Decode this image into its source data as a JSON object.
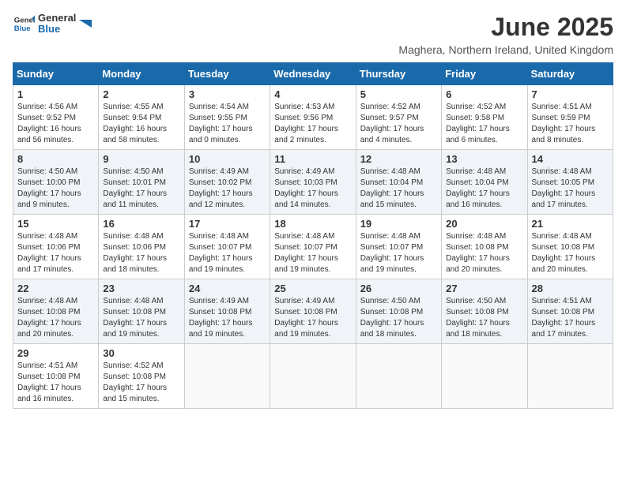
{
  "logo": {
    "general": "General",
    "blue": "Blue"
  },
  "title": "June 2025",
  "subtitle": "Maghera, Northern Ireland, United Kingdom",
  "days_header": [
    "Sunday",
    "Monday",
    "Tuesday",
    "Wednesday",
    "Thursday",
    "Friday",
    "Saturday"
  ],
  "weeks": [
    [
      {
        "day": "1",
        "sunrise": "4:56 AM",
        "sunset": "9:52 PM",
        "daylight": "16 hours and 56 minutes."
      },
      {
        "day": "2",
        "sunrise": "4:55 AM",
        "sunset": "9:54 PM",
        "daylight": "16 hours and 58 minutes."
      },
      {
        "day": "3",
        "sunrise": "4:54 AM",
        "sunset": "9:55 PM",
        "daylight": "17 hours and 0 minutes."
      },
      {
        "day": "4",
        "sunrise": "4:53 AM",
        "sunset": "9:56 PM",
        "daylight": "17 hours and 2 minutes."
      },
      {
        "day": "5",
        "sunrise": "4:52 AM",
        "sunset": "9:57 PM",
        "daylight": "17 hours and 4 minutes."
      },
      {
        "day": "6",
        "sunrise": "4:52 AM",
        "sunset": "9:58 PM",
        "daylight": "17 hours and 6 minutes."
      },
      {
        "day": "7",
        "sunrise": "4:51 AM",
        "sunset": "9:59 PM",
        "daylight": "17 hours and 8 minutes."
      }
    ],
    [
      {
        "day": "8",
        "sunrise": "4:50 AM",
        "sunset": "10:00 PM",
        "daylight": "17 hours and 9 minutes."
      },
      {
        "day": "9",
        "sunrise": "4:50 AM",
        "sunset": "10:01 PM",
        "daylight": "17 hours and 11 minutes."
      },
      {
        "day": "10",
        "sunrise": "4:49 AM",
        "sunset": "10:02 PM",
        "daylight": "17 hours and 12 minutes."
      },
      {
        "day": "11",
        "sunrise": "4:49 AM",
        "sunset": "10:03 PM",
        "daylight": "17 hours and 14 minutes."
      },
      {
        "day": "12",
        "sunrise": "4:48 AM",
        "sunset": "10:04 PM",
        "daylight": "17 hours and 15 minutes."
      },
      {
        "day": "13",
        "sunrise": "4:48 AM",
        "sunset": "10:04 PM",
        "daylight": "17 hours and 16 minutes."
      },
      {
        "day": "14",
        "sunrise": "4:48 AM",
        "sunset": "10:05 PM",
        "daylight": "17 hours and 17 minutes."
      }
    ],
    [
      {
        "day": "15",
        "sunrise": "4:48 AM",
        "sunset": "10:06 PM",
        "daylight": "17 hours and 17 minutes."
      },
      {
        "day": "16",
        "sunrise": "4:48 AM",
        "sunset": "10:06 PM",
        "daylight": "17 hours and 18 minutes."
      },
      {
        "day": "17",
        "sunrise": "4:48 AM",
        "sunset": "10:07 PM",
        "daylight": "17 hours and 19 minutes."
      },
      {
        "day": "18",
        "sunrise": "4:48 AM",
        "sunset": "10:07 PM",
        "daylight": "17 hours and 19 minutes."
      },
      {
        "day": "19",
        "sunrise": "4:48 AM",
        "sunset": "10:07 PM",
        "daylight": "17 hours and 19 minutes."
      },
      {
        "day": "20",
        "sunrise": "4:48 AM",
        "sunset": "10:08 PM",
        "daylight": "17 hours and 20 minutes."
      },
      {
        "day": "21",
        "sunrise": "4:48 AM",
        "sunset": "10:08 PM",
        "daylight": "17 hours and 20 minutes."
      }
    ],
    [
      {
        "day": "22",
        "sunrise": "4:48 AM",
        "sunset": "10:08 PM",
        "daylight": "17 hours and 20 minutes."
      },
      {
        "day": "23",
        "sunrise": "4:48 AM",
        "sunset": "10:08 PM",
        "daylight": "17 hours and 19 minutes."
      },
      {
        "day": "24",
        "sunrise": "4:49 AM",
        "sunset": "10:08 PM",
        "daylight": "17 hours and 19 minutes."
      },
      {
        "day": "25",
        "sunrise": "4:49 AM",
        "sunset": "10:08 PM",
        "daylight": "17 hours and 19 minutes."
      },
      {
        "day": "26",
        "sunrise": "4:50 AM",
        "sunset": "10:08 PM",
        "daylight": "17 hours and 18 minutes."
      },
      {
        "day": "27",
        "sunrise": "4:50 AM",
        "sunset": "10:08 PM",
        "daylight": "17 hours and 18 minutes."
      },
      {
        "day": "28",
        "sunrise": "4:51 AM",
        "sunset": "10:08 PM",
        "daylight": "17 hours and 17 minutes."
      }
    ],
    [
      {
        "day": "29",
        "sunrise": "4:51 AM",
        "sunset": "10:08 PM",
        "daylight": "17 hours and 16 minutes."
      },
      {
        "day": "30",
        "sunrise": "4:52 AM",
        "sunset": "10:08 PM",
        "daylight": "17 hours and 15 minutes."
      },
      null,
      null,
      null,
      null,
      null
    ]
  ]
}
